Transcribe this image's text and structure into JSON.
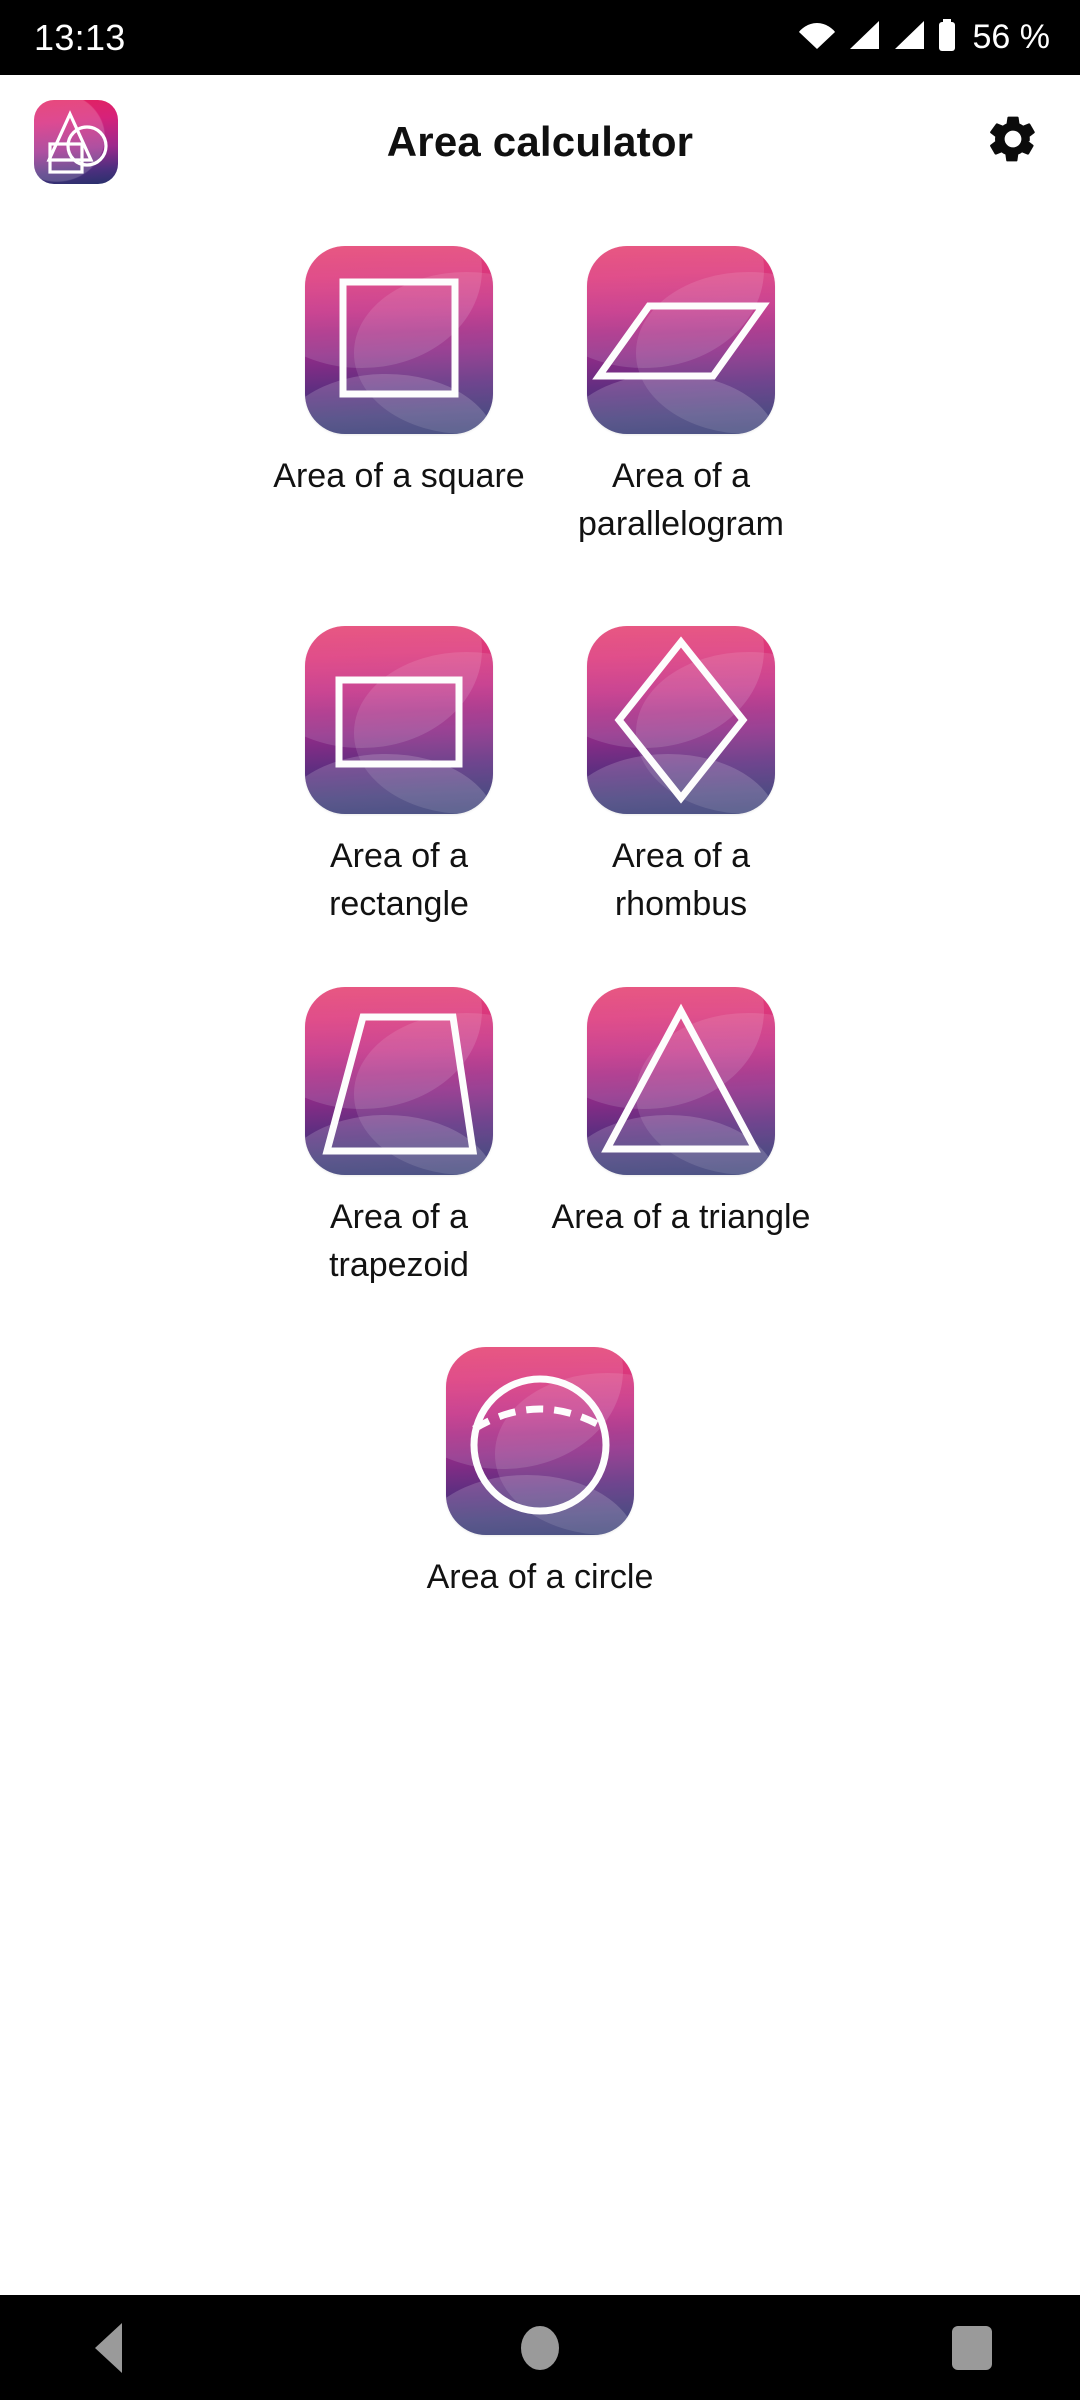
{
  "statusbar": {
    "clock": "13:13",
    "battery_text": "56 %",
    "icons": [
      "wifi-icon",
      "signal-icon",
      "signal-icon",
      "battery-icon"
    ]
  },
  "header": {
    "title": "Area calculator",
    "app_icon_name": "app-logo-icon",
    "settings_icon_name": "gear-icon"
  },
  "theme": {
    "gradient_top": "#e01f57",
    "gradient_mid": "#8e2b87",
    "gradient_bottom": "#27306b",
    "background": "#ffffff",
    "label_color": "#121212",
    "statusbar_bg": "#000000",
    "nav_icon_color": "#9a9a9a"
  },
  "grid": {
    "rows": [
      [
        {
          "label": "Area of a square",
          "shape": "square"
        },
        {
          "label": "Area of a parallelogram",
          "shape": "parallelogram"
        }
      ],
      [
        {
          "label": "Area of a rectangle",
          "shape": "rectangle"
        },
        {
          "label": "Area of a rhombus",
          "shape": "rhombus"
        }
      ],
      [
        {
          "label": "Area of a trapezoid",
          "shape": "trapezoid"
        },
        {
          "label": "Area of a triangle",
          "shape": "triangle"
        }
      ],
      [
        {
          "label": "Area of a circle",
          "shape": "circle"
        }
      ]
    ]
  },
  "navbar": {
    "back_label": "Back",
    "home_label": "Home",
    "recents_label": "Recents"
  }
}
